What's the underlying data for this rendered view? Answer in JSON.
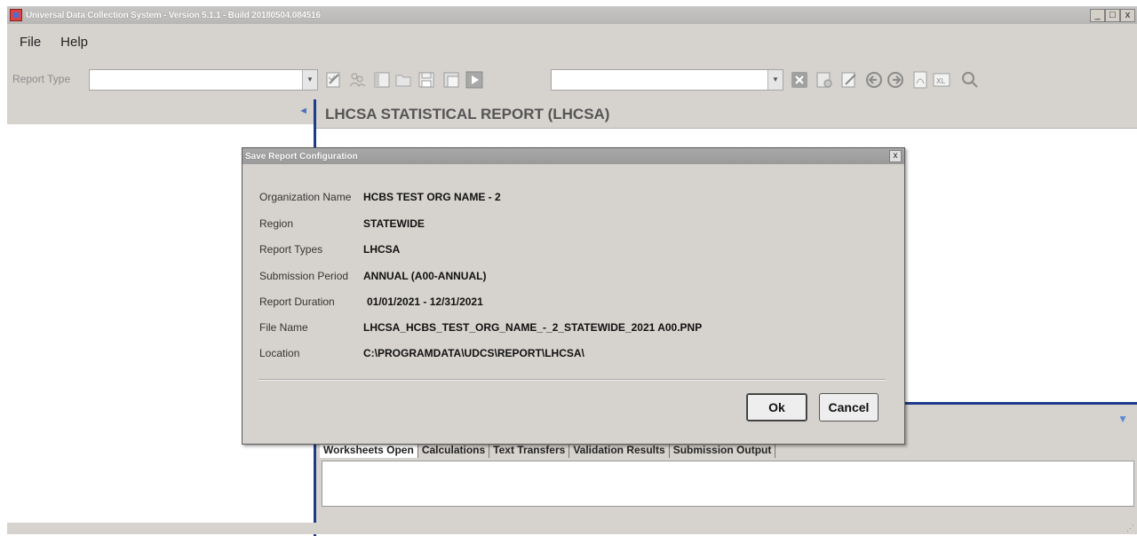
{
  "window": {
    "title": "Universal Data Collection System - Version 5.1.1 - Build 20180504.084516",
    "minimize": "_",
    "maximize": "□",
    "close": "x"
  },
  "menu": [
    "File",
    "Help"
  ],
  "toolbar": {
    "report_type_label": "Report Type",
    "report_type_value": "",
    "second_combo_value": ""
  },
  "main": {
    "title": "LHCSA STATISTICAL REPORT (LHCSA)"
  },
  "tabs": [
    "Worksheets Open",
    "Calculations",
    "Text Transfers",
    "Validation Results",
    "Submission Output"
  ],
  "dialog": {
    "title": "Save Report Configuration",
    "close": "x",
    "fields": [
      {
        "label": "Organization Name",
        "value": "HCBS TEST ORG NAME - 2"
      },
      {
        "label": "Region",
        "value": "STATEWIDE"
      },
      {
        "label": "Report Types",
        "value": "LHCSA"
      },
      {
        "label": "Submission Period",
        "value": "ANNUAL (A00-ANNUAL)"
      },
      {
        "label": "Report Duration",
        "value": "01/01/2021 - 12/31/2021"
      },
      {
        "label": "File Name",
        "value": "LHCSA_HCBS_TEST_ORG_NAME_-_2_STATEWIDE_2021 A00.PNP"
      },
      {
        "label": "Location",
        "value": "C:\\PROGRAMDATA\\UDCS\\REPORT\\LHCSA\\"
      }
    ],
    "ok_label": "Ok",
    "cancel_label": "Cancel"
  },
  "colors": {
    "accent_blue": "#1e3a8a",
    "chrome": "#d6d3ce"
  }
}
